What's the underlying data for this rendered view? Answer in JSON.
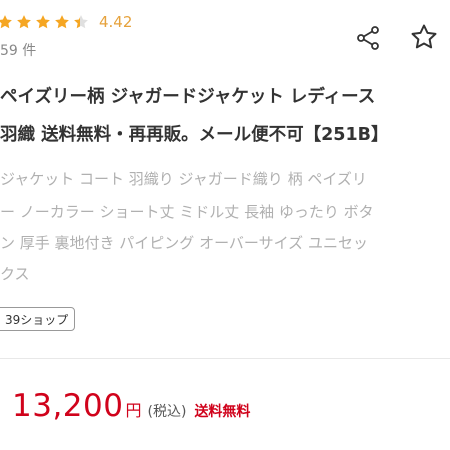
{
  "rating": {
    "value": "4.42",
    "stars": 4.42,
    "review_count": "59 件"
  },
  "actions": {
    "share_icon": "share-icon",
    "favorite_icon": "star-outline-icon"
  },
  "product": {
    "title_line1": "ペイズリー柄 ジャガードジャケット レディース",
    "title_line2": "羽織 送料無料・再再販。メール便不可【251B】",
    "tags_line1": "ジャケット コート 羽織り ジャガード織り 柄 ペイズリ",
    "tags_line2": "ー ノーカラー ショート丈 ミドル丈 長袖 ゆったり ボタ",
    "tags_line3": "ン 厚手 裏地付き パイピング オーバーサイズ ユニセッ",
    "tags_line4": "クス"
  },
  "shop": {
    "label": "39ショップ"
  },
  "price": {
    "amount": "13,200",
    "unit": "円",
    "tax": "(税込)",
    "shipping": "送料無料"
  },
  "colors": {
    "star": "#f5a623",
    "price": "#d0021b",
    "icon": "#333333"
  }
}
